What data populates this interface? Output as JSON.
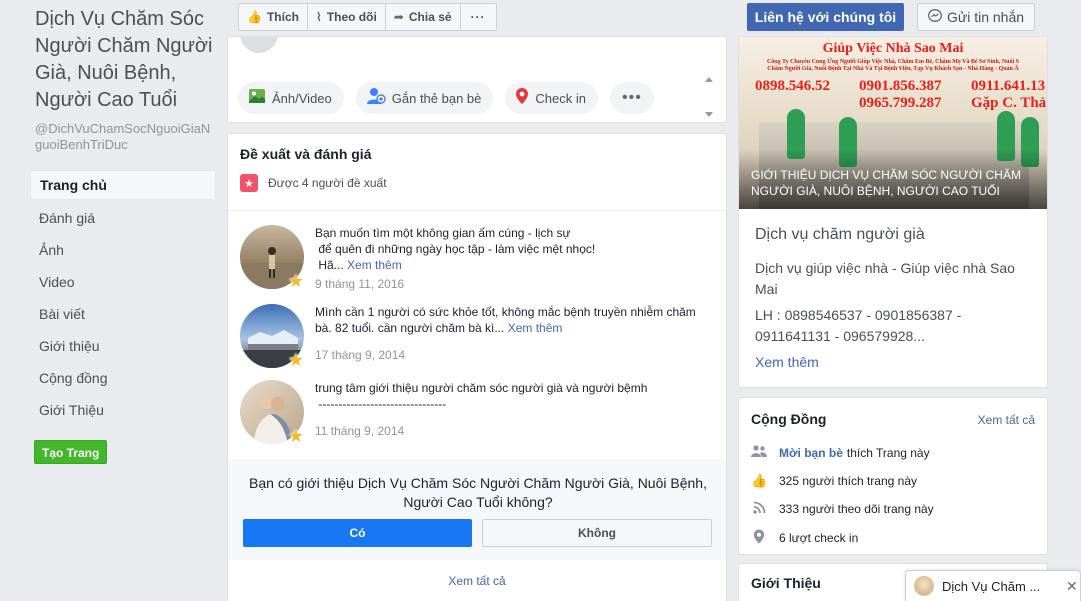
{
  "page": {
    "name": "Dịch Vụ Chăm Sóc Người Chăm Người Già, Nuôi Bệnh, Người Cao Tuổi",
    "handle": "@DichVuChamSocNguoiGiaNguoiBenhTriDuc"
  },
  "nav": {
    "items": [
      "Trang chủ",
      "Đánh giá",
      "Ảnh",
      "Video",
      "Bài viết",
      "Giới thiệu",
      "Cộng đồng",
      "Giới Thiệu"
    ],
    "active": "Trang chủ",
    "create_label": "Tạo Trang"
  },
  "action_bar": {
    "like": "Thích",
    "follow": "Theo dõi",
    "share": "Chia sẻ",
    "more": "···",
    "contact": "Liên hệ với chúng tôi",
    "message": "Gửi tin nhắn"
  },
  "composer": {
    "photo_video": "Ảnh/Video",
    "tag_friends": "Gắn thẻ bạn bè",
    "check_in": "Check in",
    "more": "•••"
  },
  "reviews": {
    "title": "Đề xuất và đánh giá",
    "count": "Được 4 người đề xuất",
    "see_more": "Xem thêm",
    "items": [
      {
        "text": "Bạn muốn tìm một không gian ấm cúng - lịch sự\n để quên đi những ngày học tập - làm việc mệt nhọc!\n Hã...",
        "more": "Xem thêm",
        "date": "9 tháng 11, 2016"
      },
      {
        "text": "Mình cần 1 người có sức khỏe tốt, không mắc bệnh truyền nhiễm chăm bà. 82 tuổi. cần người chăm bà kì...",
        "more": "Xem thêm",
        "date": "17 tháng 9, 2014"
      },
      {
        "text": "trung tâm giới thiệu người chăm sóc người già và người bệmh\n --------------------------------",
        "more": "",
        "date": "11 tháng 9, 2014"
      }
    ],
    "question": "Bạn có giới thiệu Dịch Vụ Chăm Sóc Người Chăm Người Già, Nuôi Bệnh, Người Cao Tuổi không?",
    "yes": "Có",
    "no": "Không",
    "see_all": "Xem tất cả"
  },
  "about": {
    "banner_title": "Giúp Việc Nhà Sao Mai",
    "banner_sub1": "Công Ty Chuyên Cung Ứng Người Giúp Việc Nhà, Chăm Em Bé, Chăm Mẹ Và Bé Sơ Sinh, Nuôi S",
    "banner_sub2": "Chăm Người Già, Nuôi Bệnh Tại Nhà Và Tại Bệnh Viện, Tạp Vụ Khách Sạn - Nhà Hàng - Quán Ă",
    "banner_phone1": "0898.546.52",
    "banner_phone2": "0901.856.387",
    "banner_phone3": "0911.641.13",
    "banner_phone4": "0965.799.287",
    "banner_phone5": "Gặp C. Thả",
    "banner_caption": "GIỚI THIỆU DỊCH VỤ CHĂM SÓC NGƯỜI CHĂM NGƯỜI GIÀ, NUÔI BỆNH, NGƯỜI CAO TUỔI",
    "category": "Dịch vụ chăm người già",
    "description": "Dịch vụ giúp việc nhà - Giúp việc nhà Sao Mai",
    "contact": "LH : 0898546537 - 0901856387 - 0911641131 - 096579928...",
    "see_more": "Xem thêm"
  },
  "community": {
    "title": "Cộng Đồng",
    "see_all": "Xem tất cả",
    "friends_link": "Mời bạn bè",
    "friends_text": "thích Trang này",
    "likes": "325 người thích trang này",
    "follows": "333 người theo dõi trang này",
    "checkins": "6 lượt check in"
  },
  "intro": {
    "title": "Giới Thiệu"
  },
  "chat": {
    "name": "Dịch Vụ Chăm ...",
    "close": "✕"
  },
  "colors": {
    "brand_blue": "#4267b2",
    "yes_blue": "#1877f2",
    "create_green": "#42b72a",
    "review_red": "#f35369",
    "star_gold": "#f7b928"
  }
}
